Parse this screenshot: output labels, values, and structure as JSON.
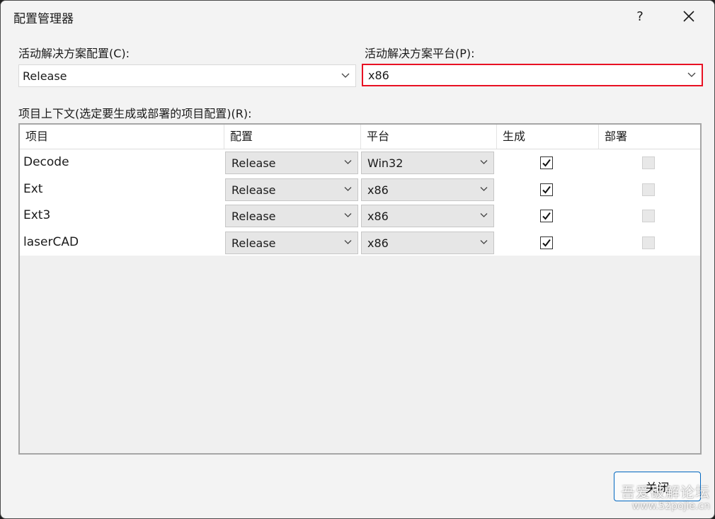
{
  "window": {
    "title": "配置管理器",
    "help_label": "?"
  },
  "active_config": {
    "label": "活动解决方案配置(C):",
    "value": "Release"
  },
  "active_platform": {
    "label": "活动解决方案平台(P):",
    "value": "x86"
  },
  "project_contexts": {
    "label": "项目上下文(选定要生成或部署的项目配置)(R):",
    "columns": [
      "项目",
      "配置",
      "平台",
      "生成",
      "部署"
    ],
    "rows": [
      {
        "project": "Decode",
        "configuration": "Release",
        "platform": "Win32",
        "build": true,
        "deploy": false
      },
      {
        "project": "Ext",
        "configuration": "Release",
        "platform": "x86",
        "build": true,
        "deploy": false
      },
      {
        "project": "Ext3",
        "configuration": "Release",
        "platform": "x86",
        "build": true,
        "deploy": false
      },
      {
        "project": "laserCAD",
        "configuration": "Release",
        "platform": "x86",
        "build": true,
        "deploy": false
      }
    ]
  },
  "footer": {
    "close_label": "关闭"
  },
  "watermark": {
    "line1": "吾爱破解论坛",
    "line2": "www.52pojie.cn"
  },
  "colors": {
    "accent": "#0067c0",
    "highlight_border": "#e81123",
    "dialog_bg": "#f3f3f3"
  },
  "icons": {
    "close": "close-icon",
    "dropdown": "chevron-down-icon",
    "check": "checkmark-icon"
  }
}
